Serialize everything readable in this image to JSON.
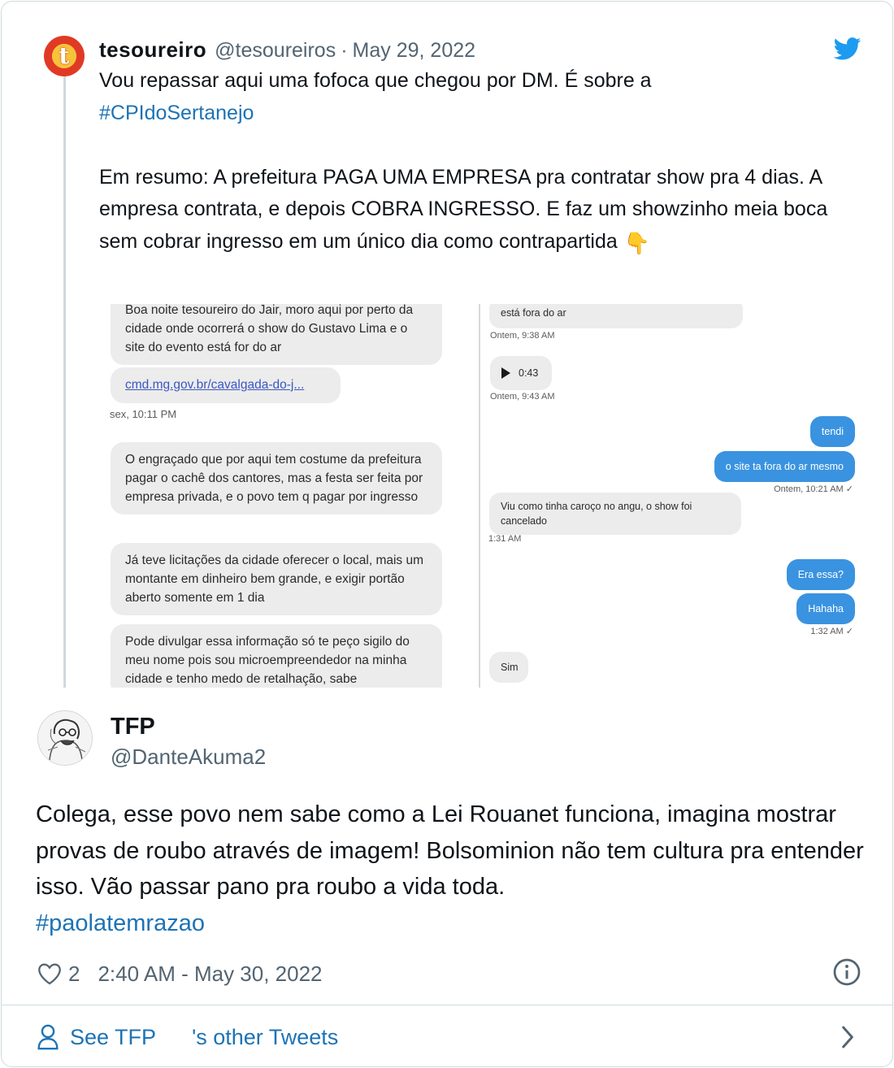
{
  "parent_tweet": {
    "name": "tesoureiro",
    "handle": "@tesoureiros",
    "separator": "·",
    "date": "May 29, 2022",
    "text_line1": "Vou repassar aqui uma fofoca que chegou por DM. É sobre a",
    "hashtag": "#CPIdoSertanejo",
    "summary": "Em resumo: A prefeitura PAGA UMA EMPRESA pra contratar show pra 4 dias. A empresa contrata, e depois COBRA INGRESSO. E faz um showzinho meia boca sem cobrar ingresso em um único dia como contrapartida",
    "emoji": "👇",
    "avatar_icon": "tesoureiro-logo-icon",
    "brand_icon": "twitter-bird-icon",
    "brand_color": "#1d9bf0"
  },
  "media": {
    "left_chat": {
      "msg1": "Boa noite tesoureiro do Jair, moro aqui por perto da cidade onde ocorrerá o show do Gustavo Lima e o site do evento está for do ar",
      "link": "cmd.mg.gov.br/cavalgada-do-j...",
      "time1": "sex, 10:11 PM",
      "msg2": "O engraçado que por aqui tem costume da prefeitura pagar o cachê dos cantores, mas a festa ser feita por empresa privada, e o povo tem q pagar por ingresso",
      "msg3": "Já teve licitações da cidade oferecer o local, mais um montante em dinheiro bem grande, e exigir portão aberto somente em 1 dia",
      "msg4": "Pode divulgar essa informação só te peço sigilo do meu nome pois sou microempreendedor na minha cidade e tenho medo de retalhação, sabe"
    },
    "right_chat": {
      "msg1": "está fora do ar",
      "time1": "Ontem, 9:38 AM",
      "audio_length": "0:43",
      "time2": "Ontem, 9:43 AM",
      "out1": "tendi",
      "out2": "o site ta fora do ar mesmo",
      "time3": "Ontem, 10:21 AM ✓",
      "msg2": "Viu como tinha caroço no angu, o show foi cancelado",
      "time4": "1:31 AM",
      "out3": "Era essa?",
      "out4": "Hahaha",
      "time5": "1:32 AM ✓",
      "msg3": "Sim"
    },
    "colors": {
      "incoming": "#ececec",
      "outgoing": "#3a93e0"
    }
  },
  "main_tweet": {
    "name": "TFP",
    "handle": "@DanteAkuma2",
    "text": "Colega, esse povo nem sabe como a Lei Rouanet funciona, imagina mostrar provas de roubo através de imagem! Bolsominion não tem cultura pra entender isso. Vão passar pano pra roubo a vida toda.",
    "hashtag": "#paolatemrazao",
    "likes": "2",
    "timestamp": "2:40 AM - May 30, 2022",
    "avatar_icon": "sketch-portrait-avatar-icon"
  },
  "footer": {
    "see_label": "See TFP",
    "see_suffix": "'s other Tweets"
  },
  "colors": {
    "link": "#1d73b5",
    "muted": "#536471",
    "text": "#0f1419",
    "border": "#cfd9de"
  }
}
